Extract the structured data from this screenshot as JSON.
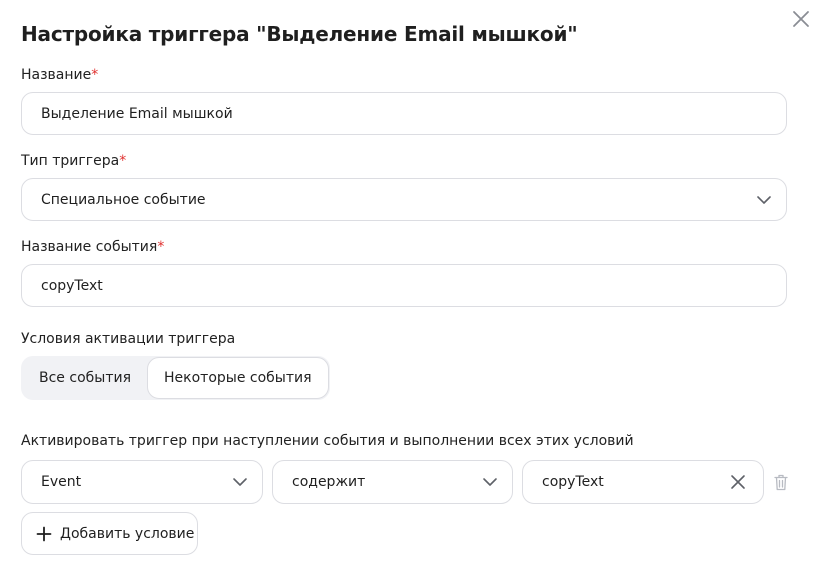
{
  "dialog": {
    "title": "Настройка триггера \"Выделение Email мышкой\"",
    "close_icon": "close-icon"
  },
  "fields": {
    "name": {
      "label": "Название",
      "required_mark": "*",
      "value": "Выделение Email мышкой"
    },
    "trigger_type": {
      "label": "Тип триггера",
      "required_mark": "*",
      "value": "Специальное событие"
    },
    "event_name": {
      "label": "Название события",
      "required_mark": "*",
      "value": "copyText"
    }
  },
  "activation": {
    "label": "Условия активации триггера",
    "options": [
      "Все события",
      "Некоторые события"
    ],
    "selected": "Некоторые события"
  },
  "conditions": {
    "label": "Активировать триггер при наступлении события и выполнении всех этих условий",
    "rows": [
      {
        "variable": "Event",
        "operator": "содержит",
        "value": "copyText"
      }
    ],
    "add_label": "Добавить условие"
  },
  "colors": {
    "required": "#e0312f",
    "border": "#dcdde2",
    "segment_bg": "#f1f2f5",
    "icon": "#8a8d94"
  }
}
